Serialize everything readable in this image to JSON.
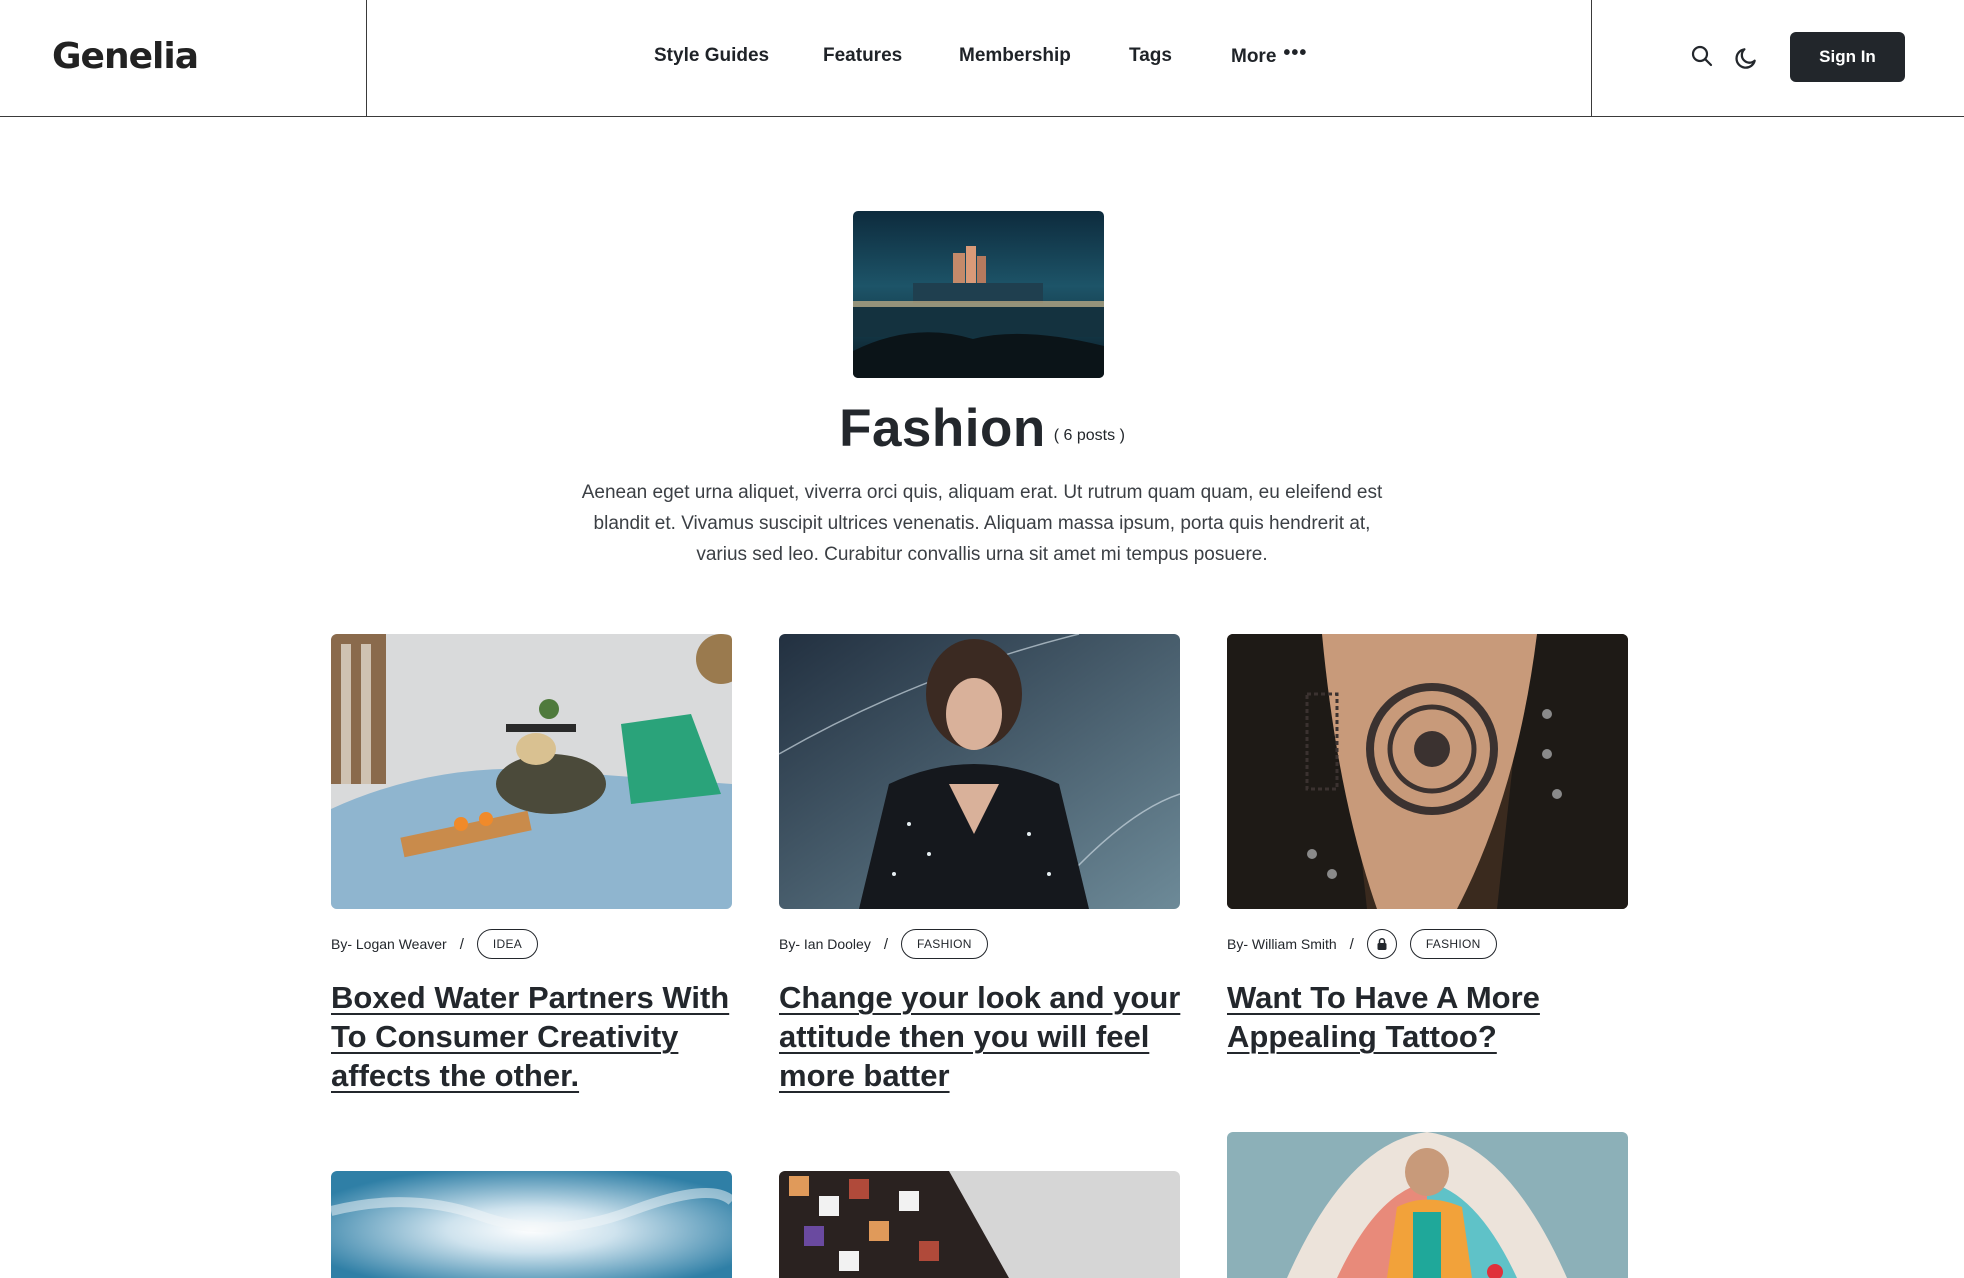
{
  "header": {
    "logo": "Genelia",
    "nav": [
      {
        "label": "Style Guides"
      },
      {
        "label": "Features"
      },
      {
        "label": "Membership"
      },
      {
        "label": "Tags"
      },
      {
        "label": "More"
      }
    ],
    "sign_in_label": "Sign In",
    "icons": [
      "search-icon",
      "moon-icon"
    ]
  },
  "hero": {
    "title": "Fashion",
    "post_count": "( 6 posts )",
    "description": "Aenean eget urna aliquet, viverra orci quis, aliquam erat. Ut rutrum quam quam, eu eleifend est blandit et. Vivamus suscipit ultrices venenatis. Aliquam massa ipsum, porta quis hendrerit at, varius sed leo. Curabitur convallis urna sit amet mi tempus posuere."
  },
  "posts": [
    {
      "author": "By- Logan Weaver",
      "separator": "/",
      "tag": "IDEA",
      "locked": false,
      "title": "Boxed Water Partners With To Consumer Creativity affects the other."
    },
    {
      "author": "By- Ian Dooley",
      "separator": "/",
      "tag": "FASHION",
      "locked": false,
      "title": "Change your look and your attitude then you will feel more batter"
    },
    {
      "author": "By- William Smith",
      "separator": "/",
      "tag": "FASHION",
      "locked": true,
      "title": "Want To Have A More Appealing Tattoo?"
    }
  ],
  "colors": {
    "text": "#23272c",
    "button_bg": "#22262b",
    "border": "#3a3a3a"
  }
}
